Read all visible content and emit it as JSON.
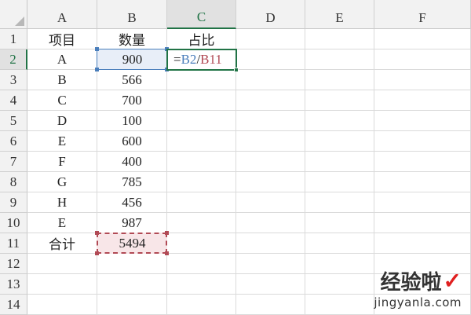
{
  "columns": [
    "A",
    "B",
    "C",
    "D",
    "E",
    "F"
  ],
  "rows": [
    "1",
    "2",
    "3",
    "4",
    "5",
    "6",
    "7",
    "8",
    "9",
    "10",
    "11",
    "12",
    "13",
    "14"
  ],
  "cells": {
    "A1": "项目",
    "B1": "数量",
    "C1": "占比",
    "A2": "A",
    "B2": "900",
    "A3": "B",
    "B3": "566",
    "A4": "C",
    "B4": "700",
    "A5": "D",
    "B5": "100",
    "A6": "E",
    "B6": "600",
    "A7": "F",
    "B7": "400",
    "A8": "G",
    "B8": "785",
    "A9": "H",
    "B9": "456",
    "A10": "E",
    "B10": "987",
    "A11": "合计",
    "B11": "5494"
  },
  "formula": {
    "cell": "C2",
    "eq": "=",
    "ref1": "B2",
    "op": "/",
    "ref2": "B11"
  },
  "colors": {
    "active": "#217346",
    "ref1": "#4a7ebb",
    "ref2": "#b14a55"
  },
  "watermark": {
    "title": "经验啦",
    "check": "✓",
    "url": "jingyanla.com"
  }
}
